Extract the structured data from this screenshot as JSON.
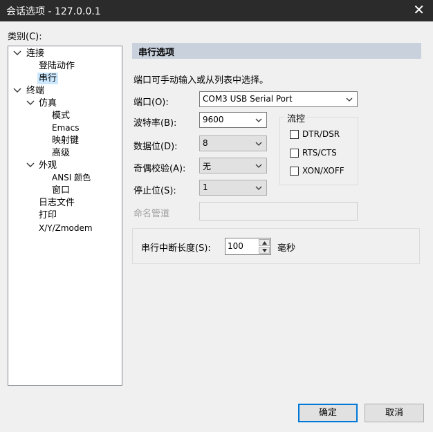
{
  "window": {
    "title": "会话选项 - 127.0.0.1",
    "close": "✕"
  },
  "category_label": "类别(C):",
  "tree": {
    "connect": "连接",
    "login_actions": "登陆动作",
    "serial": "串行",
    "terminal": "终端",
    "emulation": "仿真",
    "modes": "模式",
    "emacs": "Emacs",
    "keymap": "映射键",
    "advanced": "高级",
    "appearance": "外观",
    "ansi_color": "ANSI 颜色",
    "window": "窗口",
    "log_file": "日志文件",
    "print": "打印",
    "xyz": "X/Y/Zmodem"
  },
  "panel": {
    "header": "串行选项",
    "intro": "端口可手动输入或从列表中选择。",
    "port_label": "端口(O):",
    "port_value": "COM3 USB Serial Port",
    "baud_label": "波特率(B):",
    "baud_value": "9600",
    "data_label": "数据位(D):",
    "data_value": "8",
    "parity_label": "奇偶校验(A):",
    "parity_value": "无",
    "stop_label": "停止位(S):",
    "stop_value": "1",
    "pipe_label": "命名管道",
    "flow_title": "流控",
    "flow": [
      "DTR/DSR",
      "RTS/CTS",
      "XON/XOFF"
    ],
    "break_label": "串行中断长度(S):",
    "break_value": "100",
    "break_unit": "毫秒"
  },
  "buttons": {
    "ok": "确定",
    "cancel": "取消"
  },
  "colors": {
    "titlebar": "#2b2b2b",
    "header": "#c8d1dc",
    "selection": "#cce8ff",
    "default_border": "#0078d7"
  }
}
